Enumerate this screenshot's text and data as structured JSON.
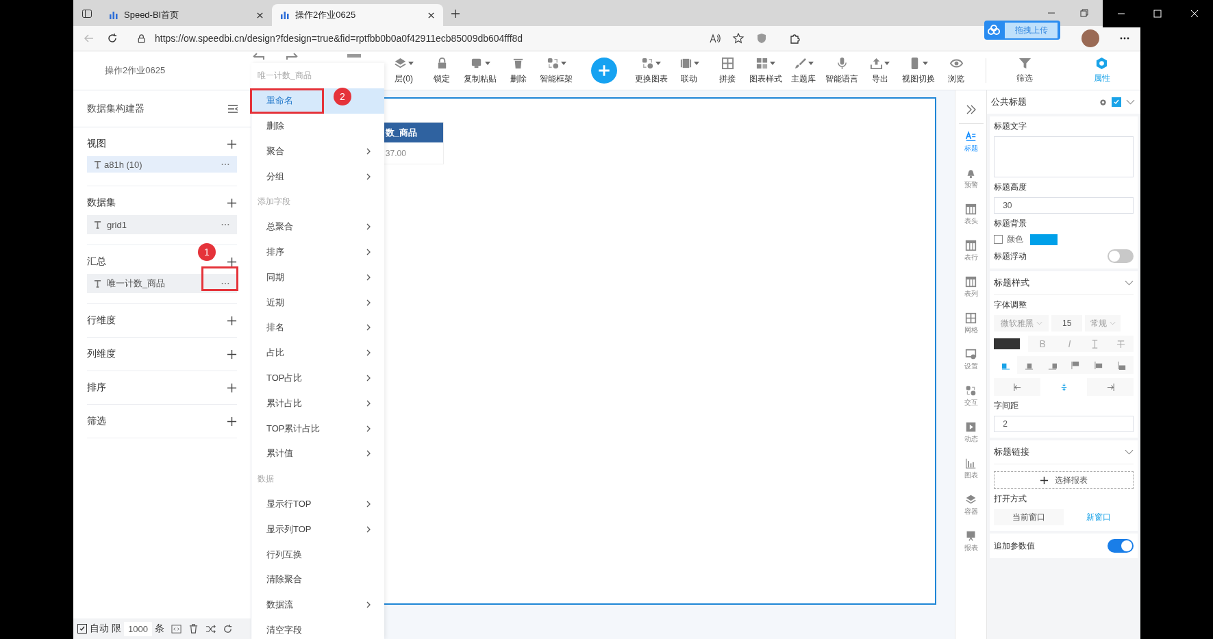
{
  "browser": {
    "tabs": [
      {
        "title": "Speed-BI首页",
        "selected": false
      },
      {
        "title": "操作2作业0625",
        "selected": true
      }
    ],
    "url": "https://ow.speedbi.cn/design?fdesign=true&fid=rptfbb0b0a0f42911ecb85009db604fff8d"
  },
  "upload_widget": {
    "label": "拖拽上传"
  },
  "app": {
    "document_title": "操作2作业0625",
    "toolbar": [
      {
        "kind": "button",
        "label": "层(0)",
        "caret": true
      },
      {
        "kind": "button",
        "label": "锁定",
        "caret": false
      },
      {
        "kind": "button",
        "label": "复制粘贴",
        "caret": true
      },
      {
        "kind": "button",
        "label": "删除",
        "caret": false
      },
      {
        "kind": "button",
        "label": "智能框架",
        "caret": true
      },
      {
        "kind": "add"
      },
      {
        "kind": "button",
        "label": "更换图表",
        "caret": true
      },
      {
        "kind": "button",
        "label": "联动",
        "caret": true
      },
      {
        "kind": "button",
        "label": "拼接",
        "caret": false
      },
      {
        "kind": "button",
        "label": "图表样式",
        "caret": true
      },
      {
        "kind": "button",
        "label": "主题库",
        "caret": true
      },
      {
        "kind": "button",
        "label": "智能语言",
        "caret": false
      },
      {
        "kind": "button",
        "label": "导出",
        "caret": true
      },
      {
        "kind": "button",
        "label": "视图切换",
        "caret": true
      },
      {
        "kind": "button",
        "label": "浏览",
        "caret": false
      }
    ],
    "panel_tabs": [
      {
        "label": "筛选",
        "selected": false
      },
      {
        "label": "属性",
        "selected": true
      }
    ]
  },
  "dataset_builder": {
    "title": "数据集构建器",
    "sections": [
      {
        "label": "视图",
        "items": [
          {
            "label": "a81h (10)",
            "selected": true
          }
        ]
      },
      {
        "label": "数据集",
        "items": [
          {
            "label": "grid1",
            "selected": false
          }
        ]
      },
      {
        "label": "汇总",
        "items": [
          {
            "label": "唯一计数_商品",
            "selected": false
          }
        ]
      },
      {
        "label": "行维度"
      },
      {
        "label": "列维度"
      },
      {
        "label": "排序"
      },
      {
        "label": "筛选"
      }
    ],
    "footer": {
      "auto_label": "自动",
      "auto_checked": true,
      "limit_label": "限",
      "limit": "1000",
      "unit": "条"
    }
  },
  "context_menu": {
    "title": "唯一计数_商品",
    "entries": [
      {
        "kind": "item",
        "label": "重命名",
        "submenu": false,
        "selected": true
      },
      {
        "kind": "item",
        "label": "删除",
        "submenu": false,
        "selected": false
      },
      {
        "kind": "item",
        "label": "聚合",
        "submenu": true,
        "selected": false
      },
      {
        "kind": "item",
        "label": "分组",
        "submenu": true,
        "selected": false
      },
      {
        "kind": "group",
        "label": "添加字段"
      },
      {
        "kind": "item",
        "label": "总聚合",
        "submenu": true,
        "selected": false
      },
      {
        "kind": "item",
        "label": "排序",
        "submenu": true,
        "selected": false
      },
      {
        "kind": "item",
        "label": "同期",
        "submenu": true,
        "selected": false
      },
      {
        "kind": "item",
        "label": "近期",
        "submenu": true,
        "selected": false
      },
      {
        "kind": "item",
        "label": "排名",
        "submenu": true,
        "selected": false
      },
      {
        "kind": "item",
        "label": "占比",
        "submenu": true,
        "selected": false
      },
      {
        "kind": "item",
        "label": "TOP占比",
        "submenu": true,
        "selected": false
      },
      {
        "kind": "item",
        "label": "累计占比",
        "submenu": true,
        "selected": false
      },
      {
        "kind": "item",
        "label": "TOP累计占比",
        "submenu": true,
        "selected": false
      },
      {
        "kind": "item",
        "label": "累计值",
        "submenu": true,
        "selected": false
      },
      {
        "kind": "group",
        "label": "数据"
      },
      {
        "kind": "item",
        "label": "显示行TOP",
        "submenu": true,
        "selected": false
      },
      {
        "kind": "item",
        "label": "显示列TOP",
        "submenu": true,
        "selected": false
      },
      {
        "kind": "item",
        "label": "行列互换",
        "submenu": false,
        "selected": false
      },
      {
        "kind": "item",
        "label": "清除聚合",
        "submenu": false,
        "selected": false
      },
      {
        "kind": "item",
        "label": "数据流",
        "submenu": true,
        "selected": false
      },
      {
        "kind": "item",
        "label": "清空字段",
        "submenu": false,
        "selected": false
      }
    ]
  },
  "canvas": {
    "table": {
      "header": "数_商品",
      "cell": "37.00"
    }
  },
  "annotations": [
    {
      "number": "1"
    },
    {
      "number": "2"
    }
  ],
  "side_tabs": [
    {
      "label": "标题",
      "selected": true
    },
    {
      "label": "预警",
      "selected": false
    },
    {
      "label": "表头",
      "selected": false
    },
    {
      "label": "表行",
      "selected": false
    },
    {
      "label": "表列",
      "selected": false
    },
    {
      "label": "网格",
      "selected": false
    },
    {
      "label": "设置",
      "selected": false
    },
    {
      "label": "交互",
      "selected": false
    },
    {
      "label": "动态",
      "selected": false
    },
    {
      "label": "图表",
      "selected": false
    },
    {
      "label": "容器",
      "selected": false
    },
    {
      "label": "报表",
      "selected": false
    }
  ],
  "properties": {
    "title": "公共标题",
    "enabled": true,
    "title_text": {
      "label": "标题文字"
    },
    "title_height": {
      "label": "标题高度",
      "value": "30"
    },
    "title_background": {
      "label": "标题背景",
      "color_label": "颜色",
      "checked": false,
      "color": "#00a0e9"
    },
    "title_float": {
      "label": "标题浮动",
      "on": false
    },
    "style": {
      "heading": "标题样式",
      "font_label": "字体调整",
      "font": "微软雅黑",
      "size": "15",
      "weight": "常规",
      "format_buttons": [
        {
          "kind": "text",
          "label": "B"
        },
        {
          "kind": "text",
          "label": "I"
        },
        {
          "kind": "overline"
        },
        {
          "kind": "strike"
        }
      ],
      "align": [
        {
          "selected": true
        },
        {
          "selected": false
        },
        {
          "selected": false
        },
        {
          "selected": false
        },
        {
          "selected": false
        },
        {
          "selected": false
        }
      ],
      "position": [
        {
          "selected": false
        },
        {
          "selected": true
        },
        {
          "selected": false
        }
      ],
      "spacing_label": "字间距",
      "spacing": "2"
    },
    "link": {
      "heading": "标题链接",
      "choose_report": "选择报表",
      "open_label": "打开方式",
      "open_modes": [
        {
          "label": "当前窗口",
          "selected": false
        },
        {
          "label": "新窗口",
          "selected": true
        }
      ]
    },
    "append_params": {
      "label": "追加参数值",
      "on": true
    }
  }
}
